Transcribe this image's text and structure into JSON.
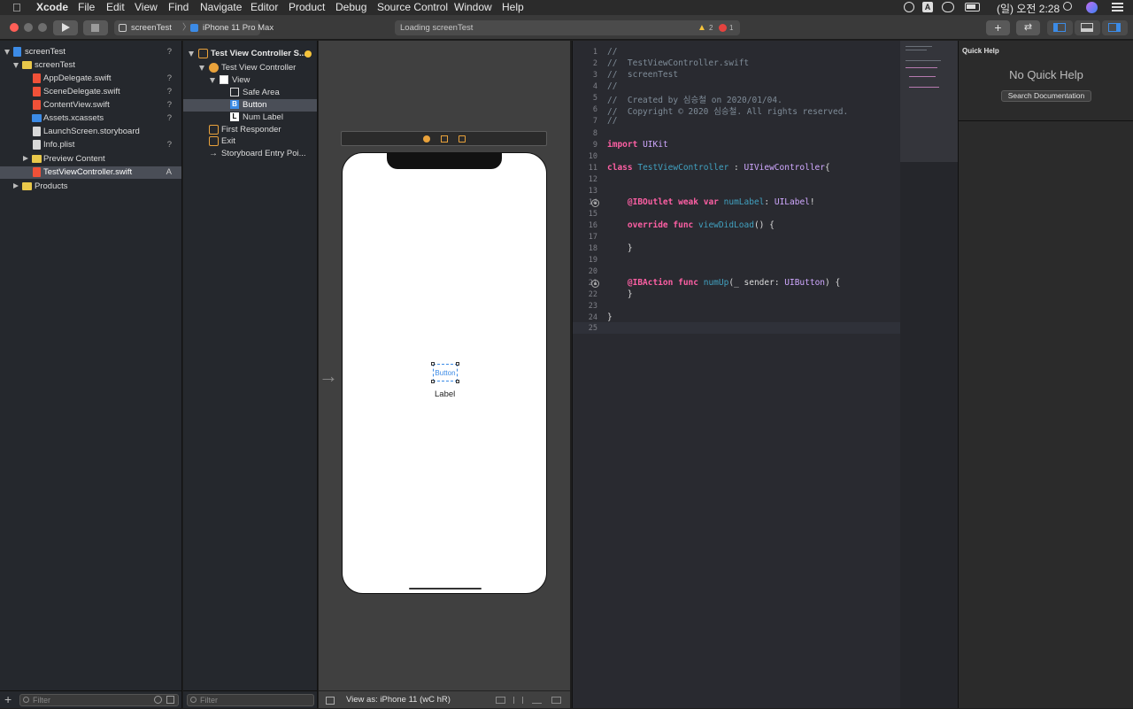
{
  "menubar": {
    "app": "Xcode",
    "items": [
      "File",
      "Edit",
      "View",
      "Find",
      "Navigate",
      "Editor",
      "Product",
      "Debug",
      "Source Control",
      "Window",
      "Help"
    ],
    "clock": "(일) 오전 2:28",
    "input_source": "A"
  },
  "toolbar": {
    "scheme": "screenTest",
    "device": "iPhone 11 Pro Max",
    "activity": "Loading screenTest",
    "warnings": "2",
    "errors": "1"
  },
  "navigator": {
    "project": "screenTest",
    "project_status": "?",
    "group": "screenTest",
    "files": [
      {
        "name": "AppDelegate.swift",
        "status": "?"
      },
      {
        "name": "SceneDelegate.swift",
        "status": "?"
      },
      {
        "name": "ContentView.swift",
        "status": "?"
      },
      {
        "name": "Assets.xcassets",
        "status": "?"
      },
      {
        "name": "LaunchScreen.storyboard",
        "status": ""
      },
      {
        "name": "Info.plist",
        "status": "?"
      },
      {
        "name": "Preview Content",
        "status": ""
      },
      {
        "name": "TestViewController.swift",
        "status": "A"
      },
      {
        "name": "Products",
        "status": ""
      }
    ],
    "filter_placeholder": "Filter"
  },
  "outline": {
    "scene": "Test View Controller S...",
    "controller": "Test View Controller",
    "view": "View",
    "safe_area": "Safe Area",
    "button": "Button",
    "num_label": "Num Label",
    "first_responder": "First Responder",
    "exit": "Exit",
    "entry": "Storyboard Entry Poi...",
    "filter_placeholder": "Filter"
  },
  "canvas": {
    "button_text": "Button",
    "label_text": "Label",
    "view_as": "View as: iPhone 11 (wC hR)"
  },
  "editor": {
    "lines": [
      {
        "n": "1",
        "t": "//"
      },
      {
        "n": "2",
        "t": "//  TestViewController.swift"
      },
      {
        "n": "3",
        "t": "//  screenTest"
      },
      {
        "n": "4",
        "t": "//"
      },
      {
        "n": "5",
        "t": "//  Created by 심승철 on 2020/01/04."
      },
      {
        "n": "6",
        "t": "//  Copyright © 2020 심승철. All rights reserved."
      },
      {
        "n": "7",
        "t": "//"
      },
      {
        "n": "8",
        "t": ""
      },
      {
        "n": "9",
        "t": "import UIKit"
      },
      {
        "n": "10",
        "t": ""
      },
      {
        "n": "11",
        "t": "class TestViewController : UIViewController{"
      },
      {
        "n": "12",
        "t": ""
      },
      {
        "n": "13",
        "t": ""
      },
      {
        "n": "14",
        "t": "    @IBOutlet weak var numLabel: UILabel!"
      },
      {
        "n": "15",
        "t": ""
      },
      {
        "n": "16",
        "t": "    override func viewDidLoad() {"
      },
      {
        "n": "17",
        "t": ""
      },
      {
        "n": "18",
        "t": "    }"
      },
      {
        "n": "19",
        "t": ""
      },
      {
        "n": "20",
        "t": ""
      },
      {
        "n": "21",
        "t": "    @IBAction func numUp(_ sender: UIButton) {"
      },
      {
        "n": "22",
        "t": "    }"
      },
      {
        "n": "23",
        "t": ""
      },
      {
        "n": "24",
        "t": "}"
      },
      {
        "n": "25",
        "t": ""
      }
    ]
  },
  "inspector": {
    "title": "Quick Help",
    "empty": "No Quick Help",
    "search_button": "Search Documentation"
  },
  "colors": {
    "keyword": "#fc5fa3",
    "type": "#d0a8ff",
    "identifier": "#41a1c0",
    "comment": "#7f8c98",
    "selection": "#4a4e57",
    "folder": "#e9c84a"
  }
}
